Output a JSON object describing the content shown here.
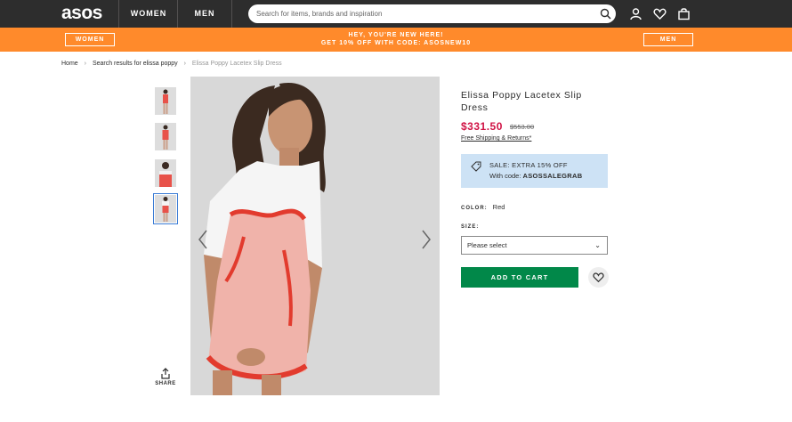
{
  "header": {
    "logo": "asos",
    "nav": {
      "women": "WOMEN",
      "men": "MEN"
    },
    "search_placeholder": "Search for items, brands and inspiration",
    "icons": [
      "search-icon",
      "account-icon",
      "heart-icon",
      "bag-icon"
    ]
  },
  "promo": {
    "women_label": "WOMEN",
    "men_label": "MEN",
    "line1": "HEY, YOU'RE NEW HERE!",
    "line2": "GET 10% OFF WITH CODE: ASOSNEW10",
    "background": "#ff8a2b"
  },
  "breadcrumb": {
    "home": "Home",
    "search": "Search results for elissa poppy",
    "current": "Elissa Poppy Lacetex Slip Dress"
  },
  "gallery": {
    "thumbnail_count": 4,
    "active_thumbnail": 4,
    "share_label": "SHARE"
  },
  "product": {
    "title": "Elissa Poppy Lacetex Slip Dress",
    "price": "$331.50",
    "old_price": "$553.00",
    "shipping": "Free Shipping & Returns*",
    "sale": {
      "line1": "SALE: EXTRA 15% OFF",
      "code_prefix": "With code: ",
      "code": "ASOSSALEGRAB"
    },
    "color_label": "COLOR:",
    "color_value": "Red",
    "size_label": "SIZE:",
    "size_selected": "Please select",
    "add_to_cart": "ADD TO CART"
  },
  "colors": {
    "price_red": "#d01345",
    "cart_green": "#018849",
    "sale_bg": "#cde2f5",
    "topbar": "#2d2d2d"
  }
}
